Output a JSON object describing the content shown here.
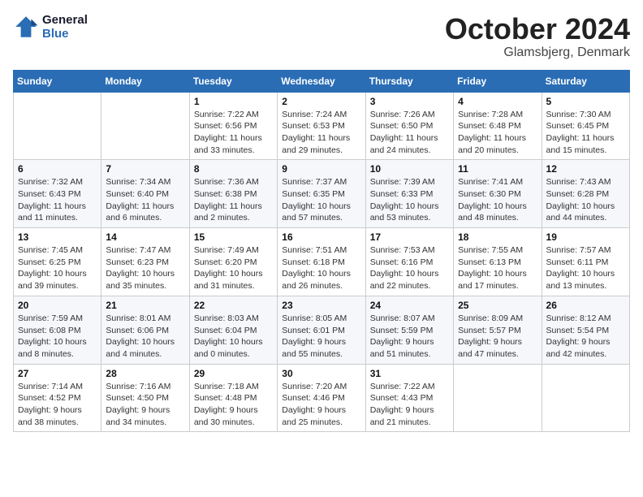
{
  "logo": {
    "line1": "General",
    "line2": "Blue"
  },
  "header": {
    "month": "October 2024",
    "location": "Glamsbjerg, Denmark"
  },
  "weekdays": [
    "Sunday",
    "Monday",
    "Tuesday",
    "Wednesday",
    "Thursday",
    "Friday",
    "Saturday"
  ],
  "weeks": [
    [
      {
        "day": "",
        "info": ""
      },
      {
        "day": "",
        "info": ""
      },
      {
        "day": "1",
        "info": "Sunrise: 7:22 AM\nSunset: 6:56 PM\nDaylight: 11 hours\nand 33 minutes."
      },
      {
        "day": "2",
        "info": "Sunrise: 7:24 AM\nSunset: 6:53 PM\nDaylight: 11 hours\nand 29 minutes."
      },
      {
        "day": "3",
        "info": "Sunrise: 7:26 AM\nSunset: 6:50 PM\nDaylight: 11 hours\nand 24 minutes."
      },
      {
        "day": "4",
        "info": "Sunrise: 7:28 AM\nSunset: 6:48 PM\nDaylight: 11 hours\nand 20 minutes."
      },
      {
        "day": "5",
        "info": "Sunrise: 7:30 AM\nSunset: 6:45 PM\nDaylight: 11 hours\nand 15 minutes."
      }
    ],
    [
      {
        "day": "6",
        "info": "Sunrise: 7:32 AM\nSunset: 6:43 PM\nDaylight: 11 hours\nand 11 minutes."
      },
      {
        "day": "7",
        "info": "Sunrise: 7:34 AM\nSunset: 6:40 PM\nDaylight: 11 hours\nand 6 minutes."
      },
      {
        "day": "8",
        "info": "Sunrise: 7:36 AM\nSunset: 6:38 PM\nDaylight: 11 hours\nand 2 minutes."
      },
      {
        "day": "9",
        "info": "Sunrise: 7:37 AM\nSunset: 6:35 PM\nDaylight: 10 hours\nand 57 minutes."
      },
      {
        "day": "10",
        "info": "Sunrise: 7:39 AM\nSunset: 6:33 PM\nDaylight: 10 hours\nand 53 minutes."
      },
      {
        "day": "11",
        "info": "Sunrise: 7:41 AM\nSunset: 6:30 PM\nDaylight: 10 hours\nand 48 minutes."
      },
      {
        "day": "12",
        "info": "Sunrise: 7:43 AM\nSunset: 6:28 PM\nDaylight: 10 hours\nand 44 minutes."
      }
    ],
    [
      {
        "day": "13",
        "info": "Sunrise: 7:45 AM\nSunset: 6:25 PM\nDaylight: 10 hours\nand 39 minutes."
      },
      {
        "day": "14",
        "info": "Sunrise: 7:47 AM\nSunset: 6:23 PM\nDaylight: 10 hours\nand 35 minutes."
      },
      {
        "day": "15",
        "info": "Sunrise: 7:49 AM\nSunset: 6:20 PM\nDaylight: 10 hours\nand 31 minutes."
      },
      {
        "day": "16",
        "info": "Sunrise: 7:51 AM\nSunset: 6:18 PM\nDaylight: 10 hours\nand 26 minutes."
      },
      {
        "day": "17",
        "info": "Sunrise: 7:53 AM\nSunset: 6:16 PM\nDaylight: 10 hours\nand 22 minutes."
      },
      {
        "day": "18",
        "info": "Sunrise: 7:55 AM\nSunset: 6:13 PM\nDaylight: 10 hours\nand 17 minutes."
      },
      {
        "day": "19",
        "info": "Sunrise: 7:57 AM\nSunset: 6:11 PM\nDaylight: 10 hours\nand 13 minutes."
      }
    ],
    [
      {
        "day": "20",
        "info": "Sunrise: 7:59 AM\nSunset: 6:08 PM\nDaylight: 10 hours\nand 8 minutes."
      },
      {
        "day": "21",
        "info": "Sunrise: 8:01 AM\nSunset: 6:06 PM\nDaylight: 10 hours\nand 4 minutes."
      },
      {
        "day": "22",
        "info": "Sunrise: 8:03 AM\nSunset: 6:04 PM\nDaylight: 10 hours\nand 0 minutes."
      },
      {
        "day": "23",
        "info": "Sunrise: 8:05 AM\nSunset: 6:01 PM\nDaylight: 9 hours\nand 55 minutes."
      },
      {
        "day": "24",
        "info": "Sunrise: 8:07 AM\nSunset: 5:59 PM\nDaylight: 9 hours\nand 51 minutes."
      },
      {
        "day": "25",
        "info": "Sunrise: 8:09 AM\nSunset: 5:57 PM\nDaylight: 9 hours\nand 47 minutes."
      },
      {
        "day": "26",
        "info": "Sunrise: 8:12 AM\nSunset: 5:54 PM\nDaylight: 9 hours\nand 42 minutes."
      }
    ],
    [
      {
        "day": "27",
        "info": "Sunrise: 7:14 AM\nSunset: 4:52 PM\nDaylight: 9 hours\nand 38 minutes."
      },
      {
        "day": "28",
        "info": "Sunrise: 7:16 AM\nSunset: 4:50 PM\nDaylight: 9 hours\nand 34 minutes."
      },
      {
        "day": "29",
        "info": "Sunrise: 7:18 AM\nSunset: 4:48 PM\nDaylight: 9 hours\nand 30 minutes."
      },
      {
        "day": "30",
        "info": "Sunrise: 7:20 AM\nSunset: 4:46 PM\nDaylight: 9 hours\nand 25 minutes."
      },
      {
        "day": "31",
        "info": "Sunrise: 7:22 AM\nSunset: 4:43 PM\nDaylight: 9 hours\nand 21 minutes."
      },
      {
        "day": "",
        "info": ""
      },
      {
        "day": "",
        "info": ""
      }
    ]
  ]
}
